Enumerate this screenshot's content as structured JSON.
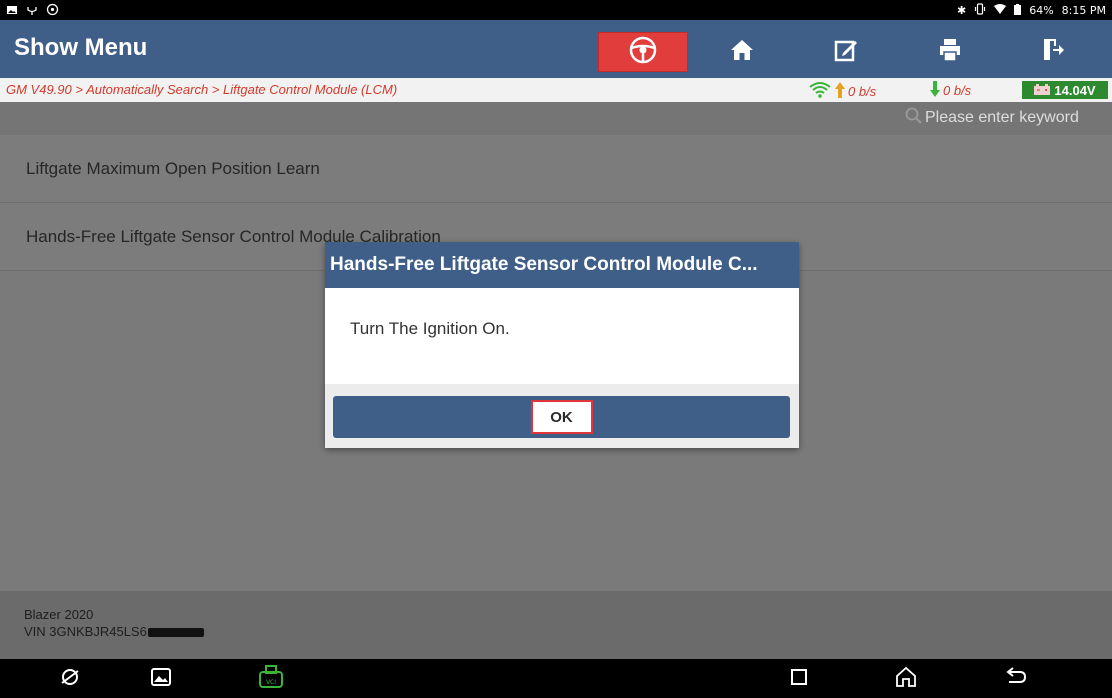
{
  "status_bar": {
    "battery": "64%",
    "time": "8:15 PM"
  },
  "header": {
    "title": "Show Menu"
  },
  "breadcrumb": {
    "path": "GM V49.90 > Automatically Search > Liftgate Control Module (LCM)",
    "upload_rate": "0 b/s",
    "download_rate": "0 b/s",
    "voltage": "14.04V"
  },
  "search": {
    "placeholder": "Please enter keyword"
  },
  "menu_items": [
    {
      "label": "Liftgate Maximum Open Position Learn"
    },
    {
      "label": "Hands-Free Liftgate Sensor Control Module Calibration"
    }
  ],
  "vehicle": {
    "model": "Blazer 2020",
    "vin_prefix": "VIN 3GNKBJR45LS6"
  },
  "dialog": {
    "title": "Hands-Free Liftgate Sensor Control Module C...",
    "message": "Turn The Ignition On.",
    "ok_label": "OK"
  },
  "colors": {
    "header_blue": "#3f5f88",
    "stop_red": "#e23d3d",
    "breadcrumb_red": "#d23a2a",
    "voltage_green": "#2e8a2e",
    "highlight_red": "#e0353a"
  }
}
